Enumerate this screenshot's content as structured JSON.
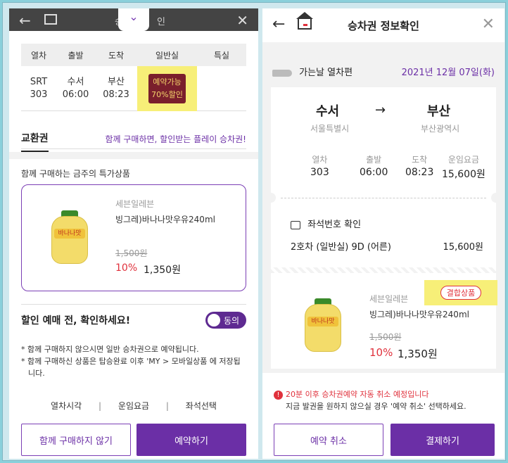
{
  "left": {
    "topbar": {
      "title_left": "승",
      "title_right": "인",
      "handle_icon": "chevron-down"
    },
    "table": {
      "headers": [
        "열차",
        "출발",
        "도착",
        "일반실",
        "특실"
      ],
      "row": {
        "train": "SRT\n303",
        "depart": "수서\n06:00",
        "arrive": "부산\n08:23",
        "general_badge": "예약가능\n70%할인",
        "special": ""
      }
    },
    "tabs": {
      "active": "교환권",
      "promo": "함께 구매하면, 할인받는 플레이 승차권!"
    },
    "product_section_title": "함께 구매하는 금주의 특가상품",
    "product": {
      "store": "세븐일레븐",
      "name": "빙그레)바나나맛우유240ml",
      "original_price": "1,500원",
      "discount_rate": "10%",
      "price": "1,350원",
      "label": "바나나맛"
    },
    "confirm": {
      "title": "할인 예매 전, 확인하세요!",
      "toggle_label": "동의",
      "toggle_on": true
    },
    "notes": [
      "* 함께 구매하지 않으시면 일반 승차권으로 예약됩니다.",
      "* 함께 구매하신 상품은 탑승완료 이후 'MY > 모바일상품 에 저장됩니다."
    ],
    "footer_links": [
      "열차시각",
      "|",
      "운임요금",
      "|",
      "좌석선택"
    ],
    "buttons": {
      "skip": "함께 구매하지 않기",
      "reserve": "예약하기"
    }
  },
  "right": {
    "header": {
      "title": "승차권 정보확인"
    },
    "direction": {
      "label": "가는날 열차편",
      "date": "2021년 12월 07일(화)"
    },
    "ticket": {
      "from": "수서",
      "from_sub": "서울특별시",
      "to": "부산",
      "to_sub": "부산광역시",
      "arrow": "→",
      "info": [
        {
          "label": "열차",
          "value": "303"
        },
        {
          "label": "출발",
          "value": "06:00"
        },
        {
          "label": "도착",
          "value": "08:23"
        },
        {
          "label": "운임요금",
          "value": "15,600원"
        }
      ],
      "seat_check": "좌석번호 확인",
      "seat": "2호차 (일반실) 9D (어른)",
      "seat_fare": "15,600원"
    },
    "combo": {
      "badge": "결합상품",
      "store": "세븐일레븐",
      "name": "빙그레)바나나맛우유240ml",
      "original_price": "1,500원",
      "discount_rate": "10%",
      "price": "1,350원",
      "label": "바나나맛"
    },
    "warning": {
      "line1": "20분 이후 승차권예약 자동 취소 예정입니다",
      "line2": "지금 발권을 원하지 않으실 경우 '예약 취소' 선택하세요."
    },
    "buttons": {
      "cancel": "예약 취소",
      "pay": "결제하기"
    }
  },
  "colors": {
    "accent": "#6b2fa6",
    "highlight": "#f7ef78",
    "discount_red": "#e0313c"
  }
}
